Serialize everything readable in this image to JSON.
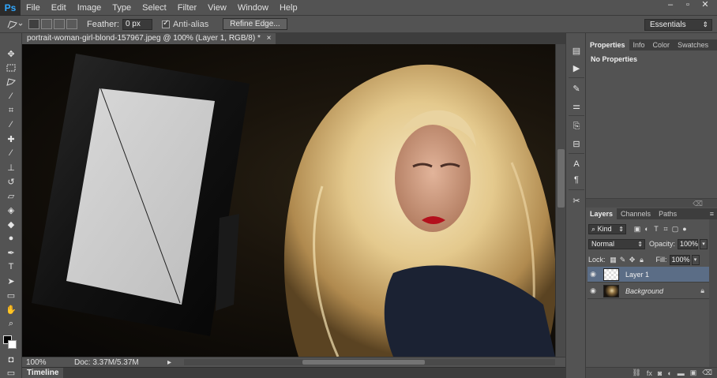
{
  "app": {
    "logo": "Ps"
  },
  "menu": [
    "File",
    "Edit",
    "Image",
    "Type",
    "Select",
    "Filter",
    "View",
    "Window",
    "Help"
  ],
  "window_controls": [
    "–",
    "▫",
    "✕"
  ],
  "options": {
    "feather_label": "Feather:",
    "feather_value": "0 px",
    "antialias_label": "Anti-alias",
    "antialias_checked": true,
    "refine_edge": "Refine Edge...",
    "workspace": "Essentials"
  },
  "document": {
    "tab_title": "portrait-woman-girl-blond-157967.jpeg @ 100% (Layer 1, RGB/8) *",
    "close": "×",
    "zoom": "100%",
    "doc_info": "Doc: 3.37M/5.37M",
    "timeline_label": "Timeline"
  },
  "colors": {
    "foreground": "#000000",
    "background": "#ffffff",
    "selected_layer": "#5b6d86"
  },
  "properties_panel": {
    "tabs": [
      "Properties",
      "Info",
      "Color",
      "Swatches"
    ],
    "active_tab": "Properties",
    "content": "No Properties"
  },
  "layers_panel": {
    "tabs": [
      "Layers",
      "Channels",
      "Paths"
    ],
    "active_tab": "Layers",
    "filter_kind": "Kind",
    "blend_mode": "Normal",
    "opacity_label": "Opacity:",
    "opacity_value": "100%",
    "lock_label": "Lock:",
    "fill_label": "Fill:",
    "fill_value": "100%",
    "layers": [
      {
        "name": "Layer 1",
        "visible": true,
        "selected": true,
        "thumb": "transparent",
        "locked": false
      },
      {
        "name": "Background",
        "visible": true,
        "selected": false,
        "thumb": "photo",
        "locked": true
      }
    ]
  }
}
